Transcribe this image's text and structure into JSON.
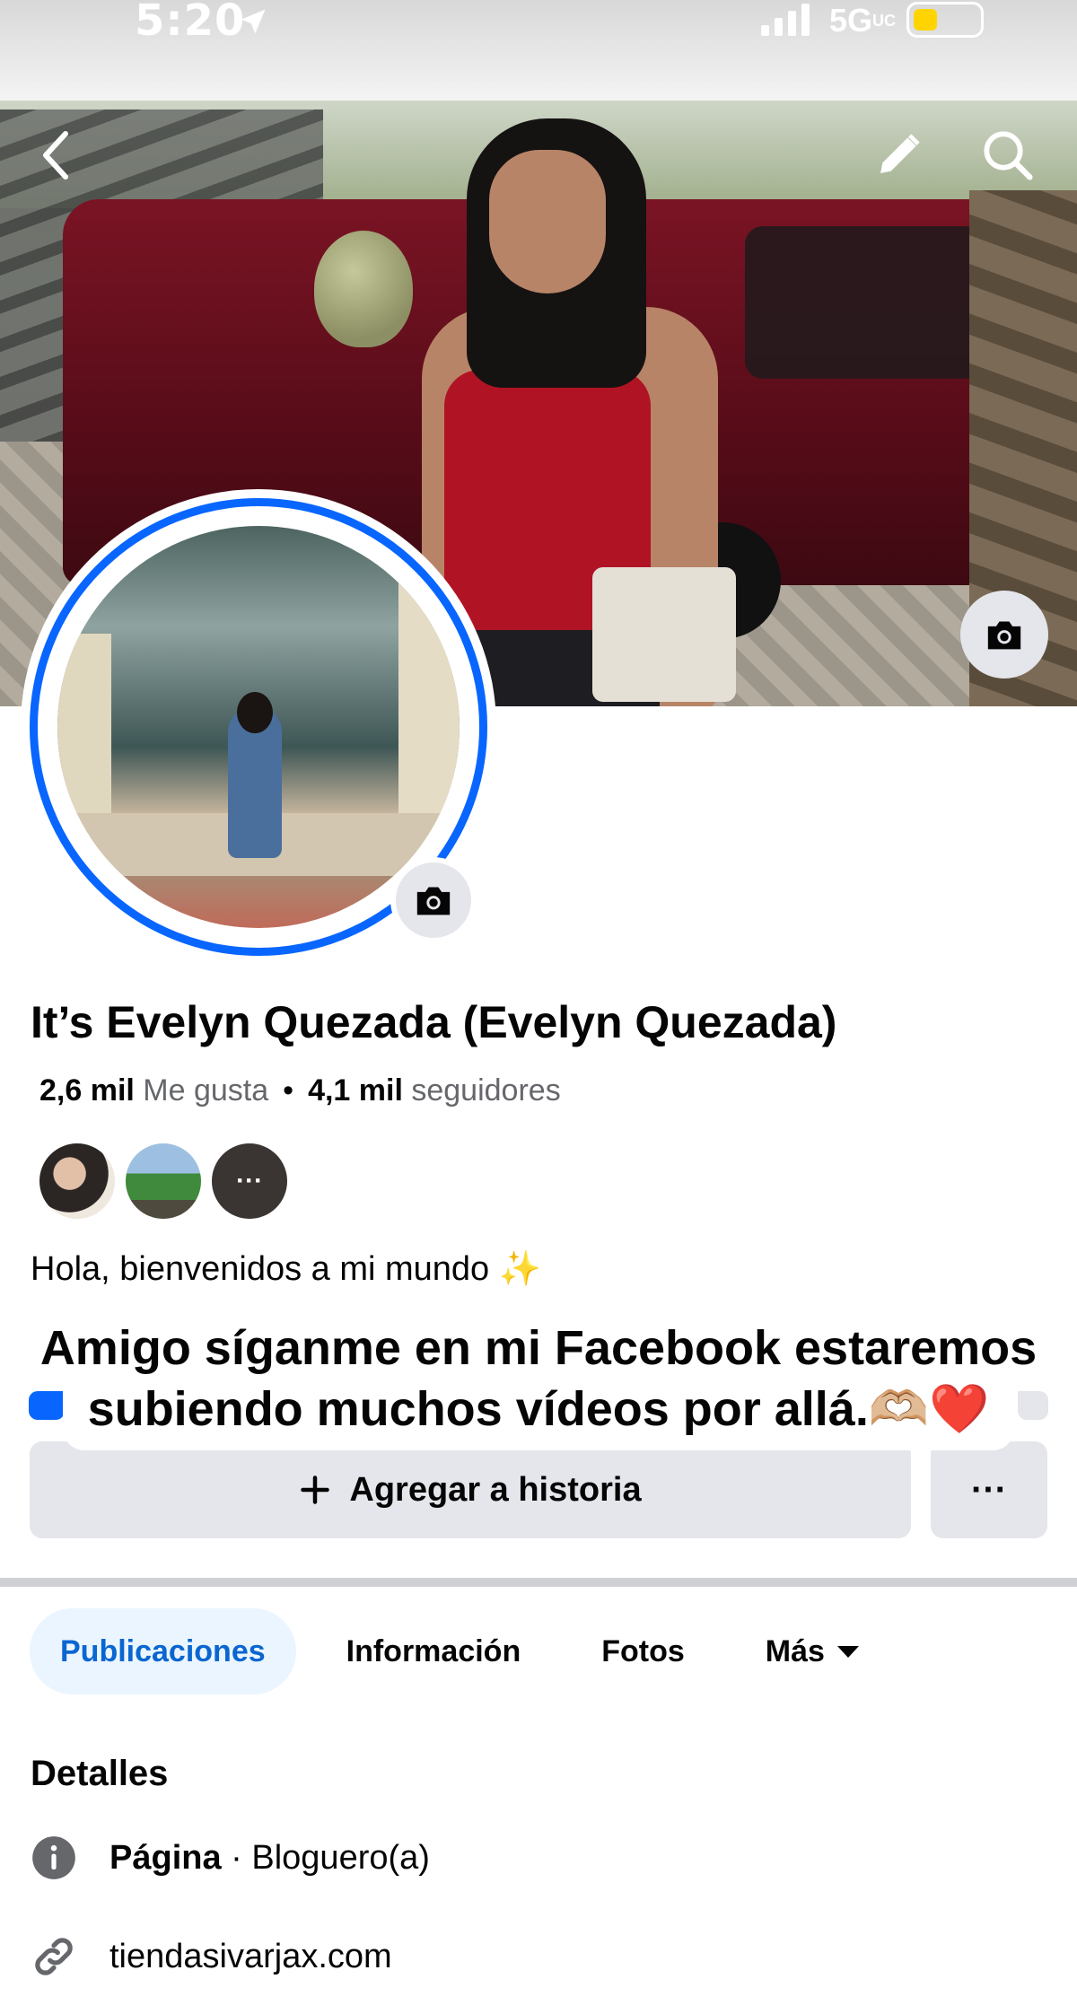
{
  "status_bar": {
    "time": "5:20",
    "network": "5G",
    "network_suffix": "UC"
  },
  "profile": {
    "name": "It’s Evelyn Quezada (Evelyn Quezada)",
    "likes_count": "2,6 mil",
    "likes_label": "Me gusta",
    "followers_count": "4,1 mil",
    "followers_label": "seguidores",
    "bio": "Hola, bienvenidos a mi mundo ✨",
    "friends_more": "···"
  },
  "caption": {
    "line1": "Amigo síganme en mi Facebook estaremos",
    "line2": "subiendo muchos vídeos por allá.🫶🏼❤️"
  },
  "actions": {
    "add_story_label": "Agregar a historia",
    "more_label": "···"
  },
  "tabs": [
    {
      "label": "Publicaciones",
      "active": true
    },
    {
      "label": "Información",
      "active": false
    },
    {
      "label": "Fotos",
      "active": false
    },
    {
      "label": "Más",
      "active": false
    }
  ],
  "details": {
    "title": "Detalles",
    "page_type_label": "Página",
    "page_type_value": " · Bloguero(a)",
    "website": "tiendasivarjax.com"
  },
  "colors": {
    "accent": "#0866ff",
    "tab_active_bg": "#ebf5ff",
    "button_bg": "#e4e6eb"
  },
  "icons": [
    "location-arrow-icon",
    "signal-icon",
    "battery-icon",
    "back-arrow-icon",
    "pencil-icon",
    "search-icon",
    "camera-icon",
    "plus-icon",
    "info-icon",
    "link-icon",
    "caret-down-icon"
  ]
}
